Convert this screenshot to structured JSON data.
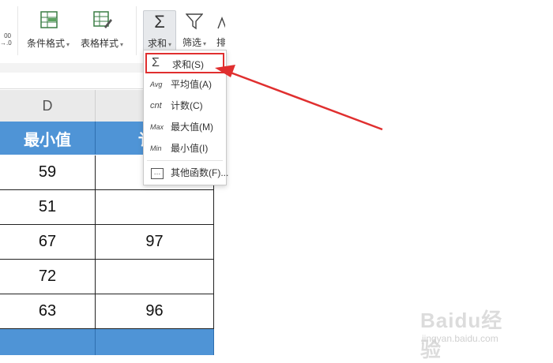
{
  "ribbon": {
    "number_format_top": "00",
    "number_format_bottom": "→.0",
    "conditional_format_label": "条件格式",
    "table_style_label": "表格样式",
    "sum_label": "求和",
    "sum_icon": "Σ",
    "filter_label": "筛选",
    "sort_label": "排"
  },
  "sheet": {
    "columns": [
      {
        "letter": "D"
      },
      {
        "letter": ""
      }
    ],
    "header_row": [
      "最小值",
      "讠"
    ],
    "rows": [
      [
        "59",
        ""
      ],
      [
        "51",
        ""
      ],
      [
        "67",
        "97"
      ],
      [
        "72",
        ""
      ],
      [
        "63",
        "96"
      ]
    ]
  },
  "sum_menu": {
    "items": [
      {
        "icon": "Σ",
        "label": "求和(S)",
        "selected": true
      },
      {
        "icon": "Avg",
        "label": "平均值(A)"
      },
      {
        "icon": "cnt",
        "label": "计数(C)"
      },
      {
        "icon": "Max",
        "label": "最大值(M)"
      },
      {
        "icon": "Min",
        "label": "最小值(I)"
      },
      {
        "icon": "…",
        "label": "其他函数(F)..."
      }
    ]
  },
  "annotation": {
    "arrow_color": "#e02f2f"
  },
  "watermark": {
    "brand": "Baidu经验",
    "url": "jingyan.baidu.com"
  },
  "colors": {
    "header_blue": "#4f94d6",
    "highlight_red": "#e02f2f"
  }
}
